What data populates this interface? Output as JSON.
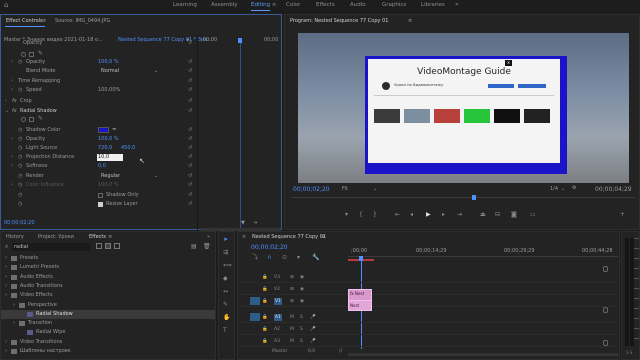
{
  "workspace_tabs": [
    "Learning",
    "Assembly",
    "Editing",
    "Color",
    "Effects",
    "Audio",
    "Graphics",
    "Libraries"
  ],
  "workspace_active": "Editing",
  "effect_controls": {
    "tab": "Effect Controls",
    "source_tab": "Source: IMG_0494.JPG",
    "clip_master": "Master * Значок видеo 2021-01-18 o...",
    "clip_active": "Nested Sequence 77 Copy 01 * Зна...",
    "tc_start": ";00;00",
    "tc_end": "00;00",
    "opacity_header": "Opacity",
    "opacity_label": "Opacity",
    "opacity_value": "100,0 %",
    "blend_label": "Blend Mode",
    "blend_value": "Normal",
    "time_remap": "Time Remapping",
    "speed_label": "Speed",
    "speed_value": "100,00%",
    "crop": "Crop",
    "radial_shadow": "Radial Shadow",
    "shadow_color": "Shadow Color",
    "opacity2_label": "Opacity",
    "opacity2_value": "100,0 %",
    "light_label": "Light Source",
    "light_x": "720,0",
    "light_y": "450,0",
    "proj_label": "Projection Distance",
    "proj_value": "10,0",
    "soft_label": "Softness",
    "soft_value": "0,0",
    "render_label": "Render",
    "render_value": "Regular",
    "color_infl_label": "Color Influence",
    "color_infl_value": "100,0 %",
    "shadow_only": "Shadow Only",
    "resize_layer": "Resize Layer",
    "timecode": "00;00;02;20"
  },
  "program": {
    "title": "Program: Nested Sequence 77 Copy 01",
    "timecode": "00;00;02;20",
    "fit": "Fit",
    "fraction": "1/4",
    "duration": "00;00;04;29",
    "video_title": "VideoMontage Guide",
    "channel": "Уроки по Видеомонтажу",
    "shadow_color": "#1a13c8"
  },
  "effects_panel": {
    "tabs": [
      "History",
      "Project: Уроки",
      "Effects"
    ],
    "search_value": "radial",
    "tree": [
      {
        "label": "Presets",
        "depth": 0,
        "kind": "folder"
      },
      {
        "label": "Lumetri Presets",
        "depth": 0,
        "kind": "folder"
      },
      {
        "label": "Audio Effects",
        "depth": 0,
        "kind": "folder"
      },
      {
        "label": "Audio Transitions",
        "depth": 0,
        "kind": "folder"
      },
      {
        "label": "Video Effects",
        "depth": 0,
        "kind": "folder"
      },
      {
        "label": "Perspective",
        "depth": 1,
        "kind": "folder"
      },
      {
        "label": "Radial Shadow",
        "depth": 2,
        "kind": "effect",
        "selected": true
      },
      {
        "label": "Transition",
        "depth": 1,
        "kind": "folder"
      },
      {
        "label": "Radial Wipe",
        "depth": 2,
        "kind": "effect"
      },
      {
        "label": "Video Transitions",
        "depth": 0,
        "kind": "folder"
      },
      {
        "label": "Шаблоны настроек",
        "depth": 0,
        "kind": "folder"
      }
    ]
  },
  "timeline": {
    "title": "Nested Sequence 77 Copy 01",
    "timecode": "00;00;02;20",
    "ruler": [
      ";00;00",
      "00;00;14;29",
      "00;00;29;29",
      "00;00;44;28"
    ],
    "tracks": [
      "V3",
      "V2",
      "V1",
      "A1",
      "A2",
      "A3"
    ],
    "master_label": "Master",
    "master_value": "0,0",
    "clip_v1": "fx Nest",
    "clip_a1": "Nest"
  }
}
